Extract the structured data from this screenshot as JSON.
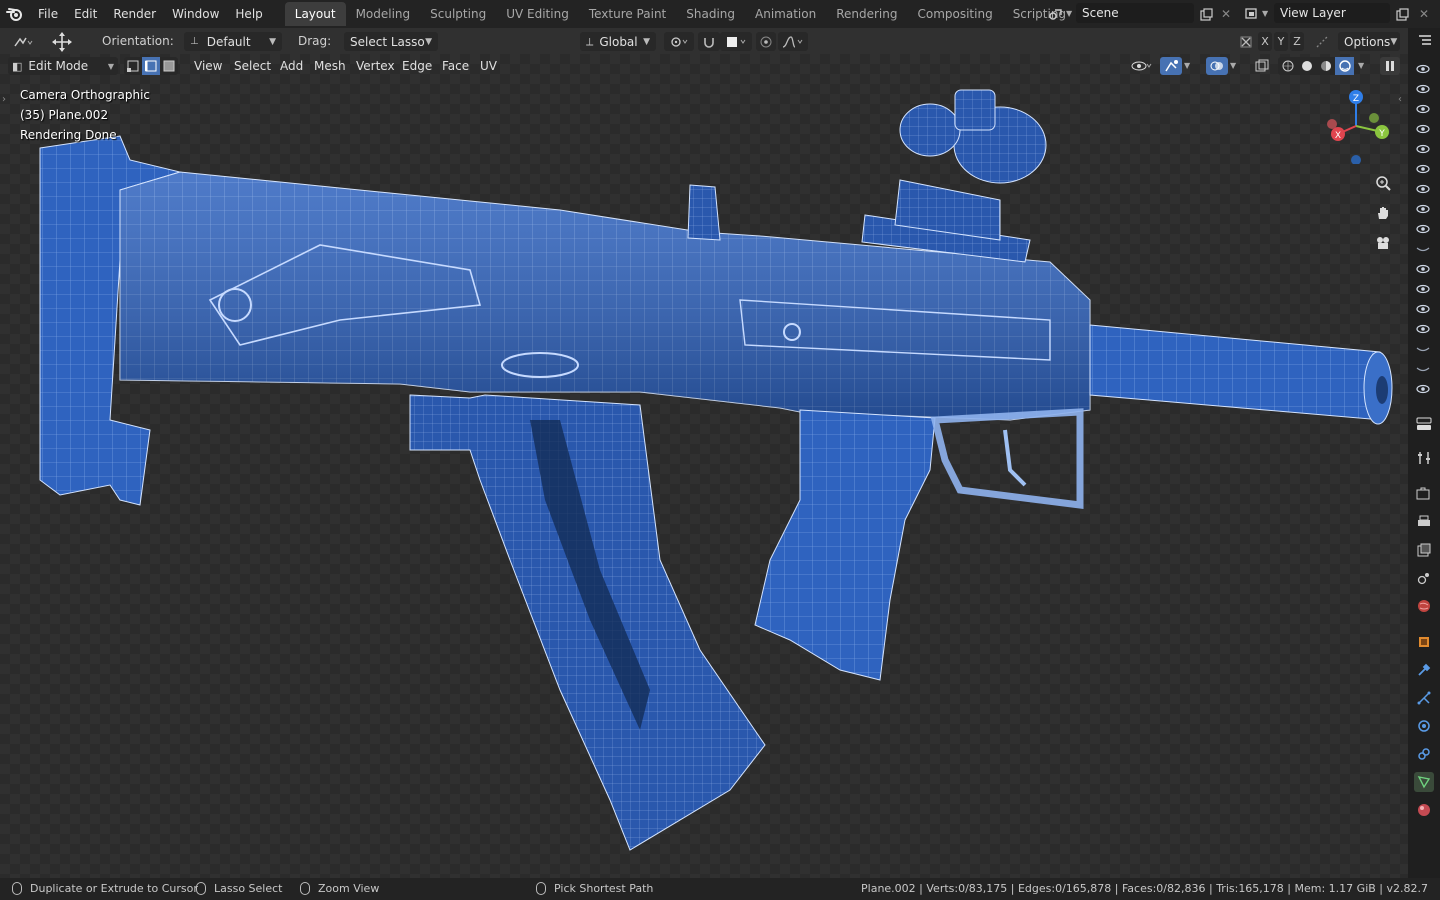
{
  "menu": {
    "items": [
      "File",
      "Edit",
      "Render",
      "Window",
      "Help"
    ]
  },
  "workspaces": {
    "tabs": [
      "Layout",
      "Modeling",
      "Sculpting",
      "UV Editing",
      "Texture Paint",
      "Shading",
      "Animation",
      "Rendering",
      "Compositing",
      "Scripting"
    ],
    "active": "Layout",
    "add_label": "+"
  },
  "scene": {
    "name": "Scene"
  },
  "view_layer": {
    "name": "View Layer"
  },
  "tool_header": {
    "orientation_label": "Orientation:",
    "orientation_value": "Default",
    "drag_label": "Drag:",
    "drag_value": "Select Lasso",
    "transform_orientation": "Global",
    "axis_x": "X",
    "axis_y": "Y",
    "axis_z": "Z",
    "options_label": "Options"
  },
  "viewport_header": {
    "mode": "Edit Mode",
    "menus": [
      "View",
      "Select",
      "Add",
      "Mesh",
      "Vertex",
      "Edge",
      "Face",
      "UV"
    ]
  },
  "viewport_overlay": {
    "line1": "Camera Orthographic",
    "line2": "(35) Plane.002",
    "line3": "Rendering Done"
  },
  "gizmo": {
    "x": "X",
    "y": "Y",
    "z": "Z"
  },
  "status": {
    "left_action": "Duplicate or Extrude to Cursor",
    "middle_action": "Lasso Select",
    "right_action": "Zoom View",
    "extra_action": "Pick Shortest Path",
    "stats": "Plane.002 | Verts:0/83,175 | Edges:0/165,878 | Faces:0/82,836 | Tris:165,178 | Mem: 1.17 GiB | v2.82.7"
  },
  "colors": {
    "accent": "#4772b3",
    "mesh_blue": "#2b5fb8",
    "axis_x": "#e0454f",
    "axis_y": "#8bc53f",
    "axis_z": "#2f7ee8"
  }
}
